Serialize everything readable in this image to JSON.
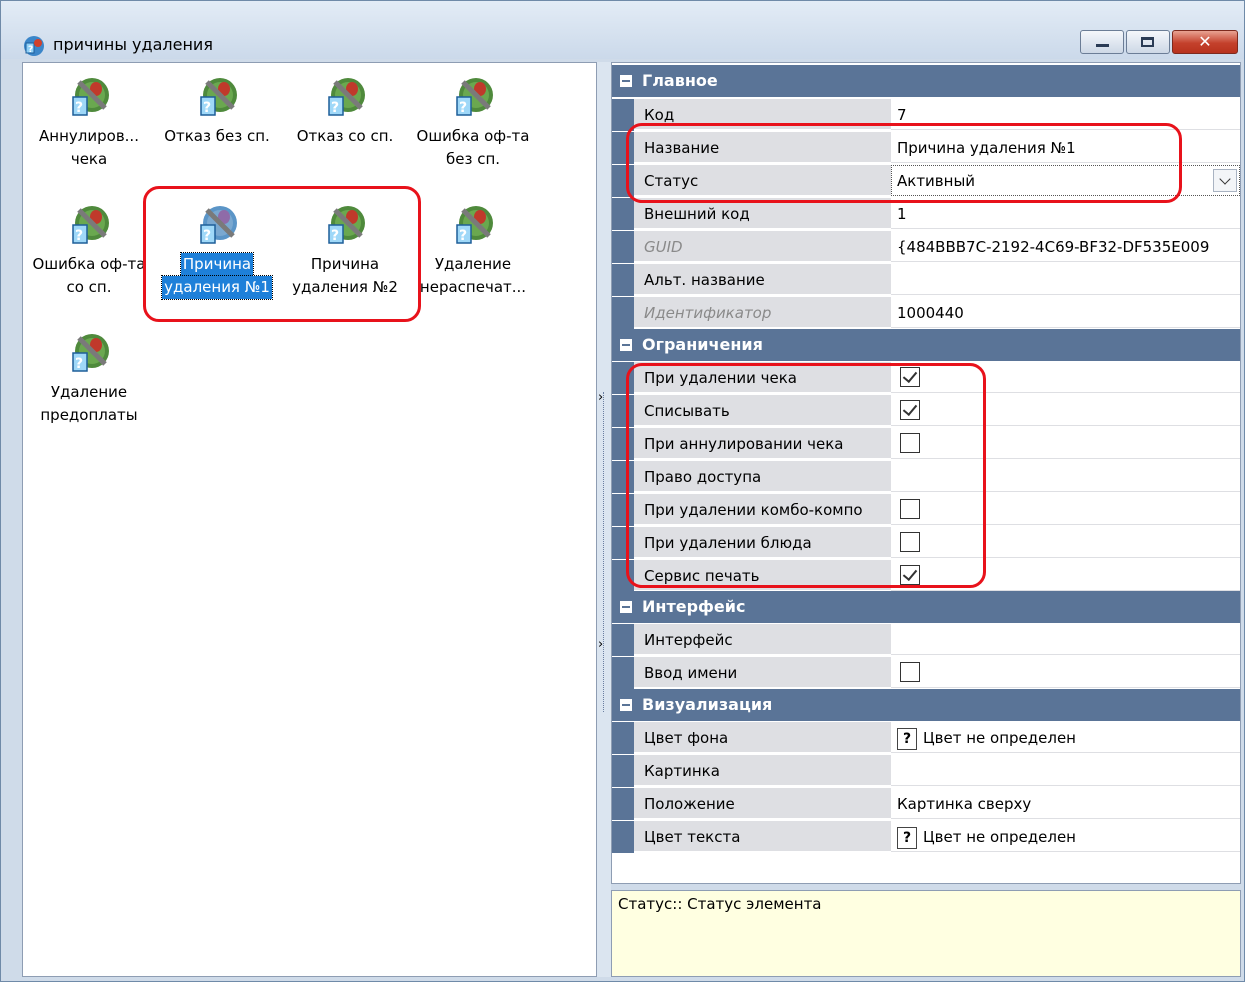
{
  "window": {
    "title": "причины удаления"
  },
  "list_items": [
    {
      "label_line1": "Аннулиров...",
      "label_line2": "чека",
      "selected": false
    },
    {
      "label_line1": "Отказ без сп.",
      "label_line2": "",
      "selected": false
    },
    {
      "label_line1": "Отказ со сп.",
      "label_line2": "",
      "selected": false
    },
    {
      "label_line1": "Ошибка оф-та",
      "label_line2": "без сп.",
      "selected": false
    },
    {
      "label_line1": "Ошибка оф-та",
      "label_line2": "со сп.",
      "selected": false
    },
    {
      "label_line1": "Причина",
      "label_line2": "удаления №1",
      "selected": true
    },
    {
      "label_line1": "Причина",
      "label_line2": "удаления №2",
      "selected": false
    },
    {
      "label_line1": "Удаление",
      "label_line2": "нераспечат...",
      "selected": false
    },
    {
      "label_line1": "Удаление",
      "label_line2": "предоплаты",
      "selected": false
    }
  ],
  "props": {
    "main": {
      "header": "Главное",
      "code_label": "Код",
      "code_value": "7",
      "name_label": "Название",
      "name_value": "Причина удаления №1",
      "status_label": "Статус",
      "status_value": "Активный",
      "ext_code_label": "Внешний код",
      "ext_code_value": "1",
      "guid_label": "GUID",
      "guid_value": "{484BBB7C-2192-4C69-BF32-DF535E009",
      "alt_name_label": "Альт. название",
      "alt_name_value": "",
      "id_label": "Идентификатор",
      "id_value": "1000440"
    },
    "limits": {
      "header": "Ограничения",
      "rows": [
        {
          "label": "При удалении чека",
          "checked": true
        },
        {
          "label": "Списывать",
          "checked": true
        },
        {
          "label": "При аннулировании чека",
          "checked": false
        },
        {
          "label": "Право доступа",
          "checked": null
        },
        {
          "label": "При удалении комбо-компо",
          "checked": false
        },
        {
          "label": "При удалении блюда",
          "checked": false
        },
        {
          "label": "Сервис печать",
          "checked": true
        }
      ]
    },
    "interface": {
      "header": "Интерфейс",
      "iface_label": "Интерфейс",
      "name_input_label": "Ввод имени",
      "name_input_checked": false
    },
    "visual": {
      "header": "Визуализация",
      "bg_label": "Цвет фона",
      "bg_value": "Цвет не определен",
      "pic_label": "Картинка",
      "pos_label": "Положение",
      "pos_value": "Картинка сверху",
      "text_color_label": "Цвет текста",
      "text_color_value": "Цвет не определен"
    }
  },
  "help_text": "Статус:: Статус элемента",
  "colors": {
    "category_bar": "#5a7497",
    "selection": "#1e80d9",
    "annotation": "#e8121b",
    "help_bg": "#ffffe1"
  }
}
